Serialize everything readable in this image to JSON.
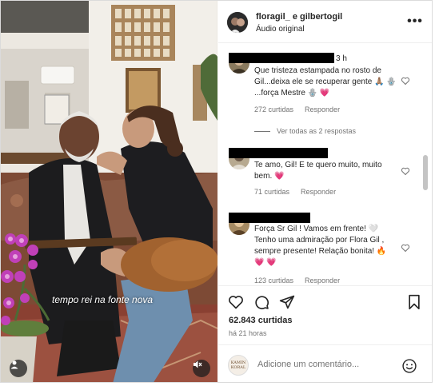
{
  "post": {
    "header": {
      "title": "floragil_ e gilbertogil",
      "subtitle": "Áudio original",
      "more_icon": "more-horizontal-icon"
    },
    "media": {
      "overlay_text": "tempo rei na fonte nova",
      "user_icon": "user-icon",
      "mute_icon": "speaker-muted-icon"
    },
    "comments": [
      {
        "time": "3 h",
        "text": "Que tristeza estampada no rosto de Gil...deixa ele se recuperar gente 🙏🏽 🪬 ...força Mestre 🪬 💗",
        "likes": "272 curtidas",
        "reply": "Responder"
      },
      {
        "text": "Te amo, Gil! E te quero muito, muito bem. 💗",
        "likes": "71 curtidas",
        "reply": "Responder"
      },
      {
        "text": "Força Sr Gil ! Vamos em frente! 🤍 Tenho uma admiração por Flora Gil , sempre presente! Relação bonita! 🔥 💗 💗",
        "likes": "123 curtidas",
        "reply": "Responder"
      }
    ],
    "view_replies": "Ver todas as 2 respostas",
    "like_count": "62.843 curtidas",
    "time_ago": "há 21 horas",
    "add_comment": {
      "placeholder": "Adicione um comentário...",
      "avatar_text": "KAMIN KORAL"
    },
    "icons": {
      "like": "heart-icon",
      "comment": "comment-icon",
      "share": "share-icon",
      "save": "bookmark-icon",
      "emoji": "emoji-icon"
    }
  }
}
